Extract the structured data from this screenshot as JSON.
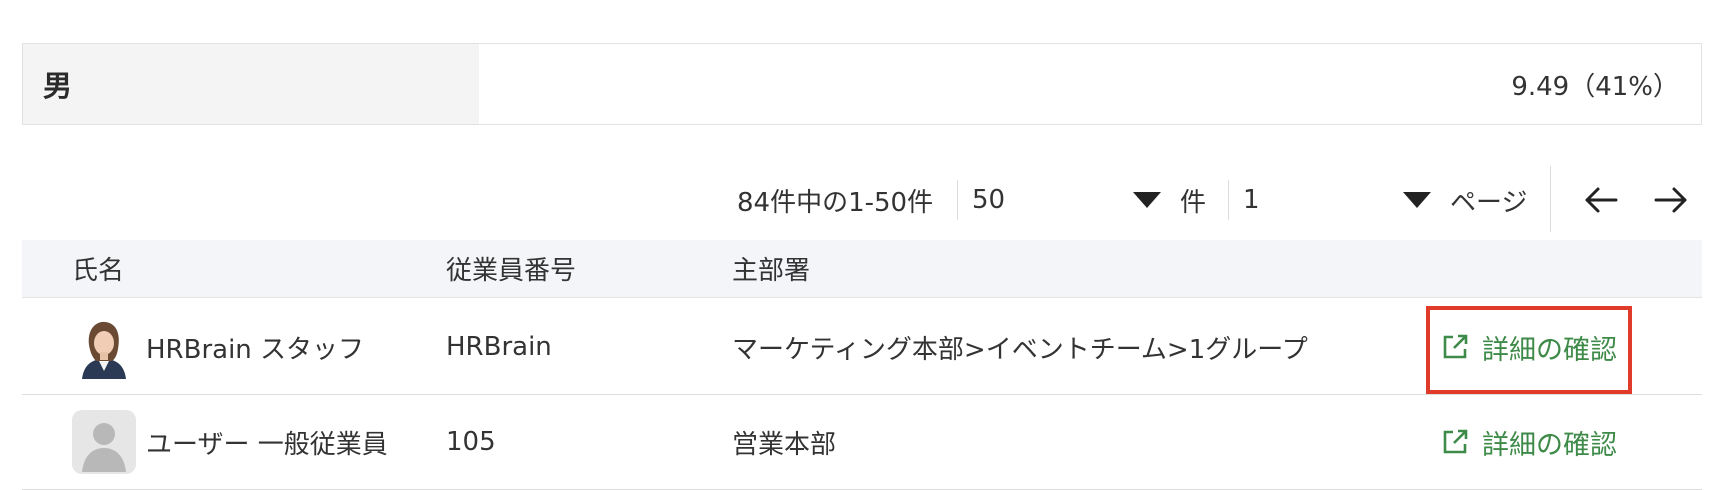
{
  "summary": {
    "label": "男",
    "value": "9.49（41%）"
  },
  "pager": {
    "range_text": "84件中の1-50件",
    "per_page": "50",
    "per_page_unit": "件",
    "page": "1",
    "page_unit": "ページ"
  },
  "table": {
    "headers": {
      "name": "氏名",
      "employee_no": "従業員番号",
      "department": "主部署"
    },
    "rows": [
      {
        "name": "HRBrain スタッフ",
        "employee_no": "HRBrain",
        "department": "マーケティング本部>イベントチーム>1グループ",
        "action": "詳細の確認",
        "avatar": "photo"
      },
      {
        "name": "ユーザー 一般従業員",
        "employee_no": "105",
        "department": "営業本部",
        "action": "詳細の確認",
        "avatar": "placeholder"
      }
    ]
  },
  "colors": {
    "link": "#3e8a48",
    "highlight": "#e03a2a",
    "header_bg": "#f3f5f8"
  }
}
